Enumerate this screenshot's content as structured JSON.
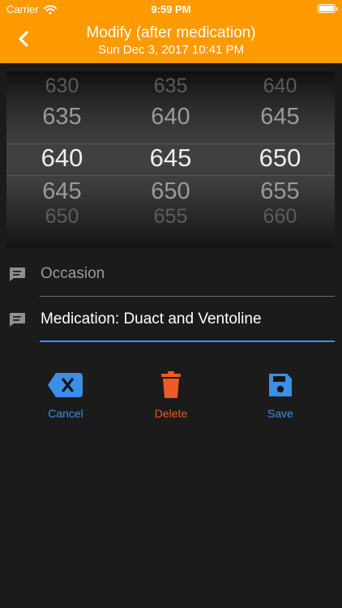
{
  "status_bar": {
    "carrier": "Carrier",
    "time": "9:59 PM"
  },
  "header": {
    "title": "Modify (after medication)",
    "subtitle": "Sun Dec 3, 2017 10:41 PM",
    "back_icon": "chevron-left-icon",
    "background_color": "#ff9a00"
  },
  "picker": {
    "columns": [
      [
        "630",
        "635",
        "640",
        "645",
        "650"
      ],
      [
        "635",
        "640",
        "645",
        "650",
        "655"
      ],
      [
        "640",
        "645",
        "650",
        "655",
        "660"
      ]
    ],
    "selected": [
      "640",
      "645",
      "650"
    ]
  },
  "fields": {
    "occasion": {
      "placeholder": "Occasion",
      "icon": "comment-icon"
    },
    "note": {
      "value": "Medication: Duact and Ventoline",
      "icon": "comment-icon"
    }
  },
  "actions": {
    "cancel": {
      "label": "Cancel",
      "icon": "backspace-icon",
      "color": "#3b8fe8"
    },
    "delete": {
      "label": "Delete",
      "icon": "trash-icon",
      "color": "#f05a24"
    },
    "save": {
      "label": "Save",
      "icon": "save-icon",
      "color": "#3b8fe8"
    }
  }
}
